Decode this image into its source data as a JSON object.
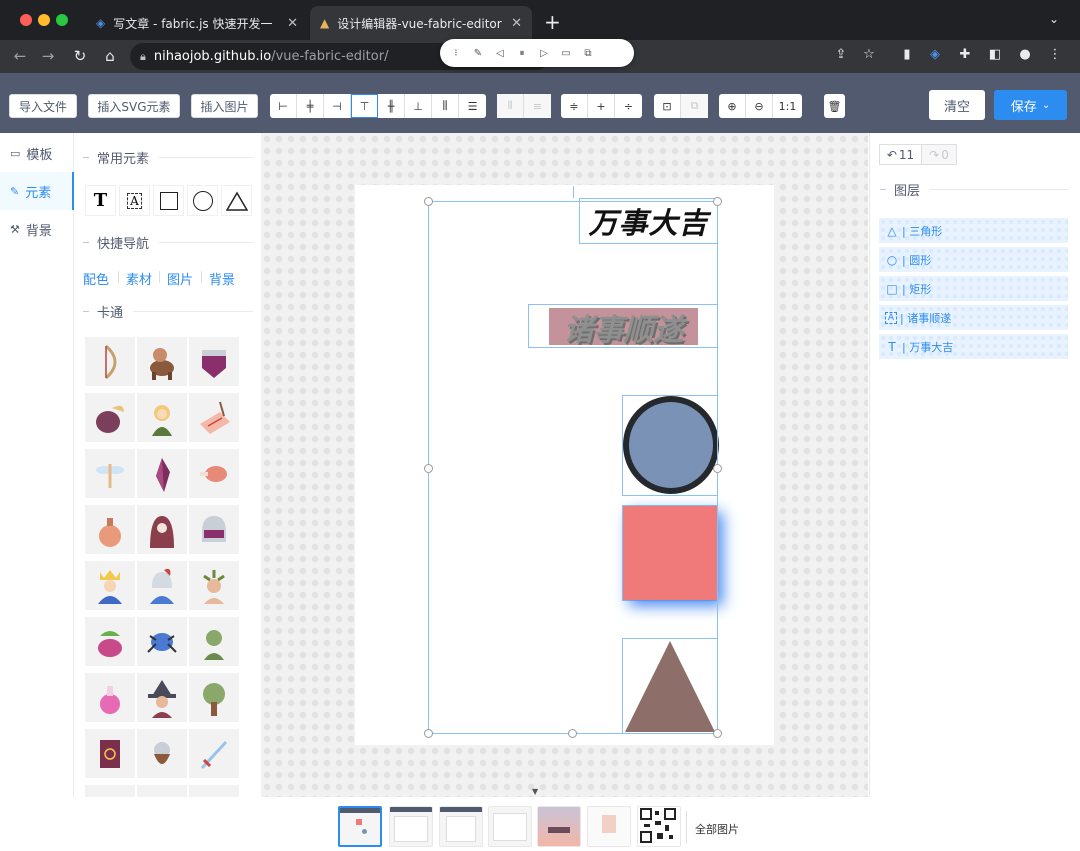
{
  "browser": {
    "tabs": [
      {
        "title": "写文章 - fabric.js 快速开发一个"
      },
      {
        "title": "设计编辑器-vue-fabric-editor"
      }
    ],
    "new_tab": "+",
    "url_host": "nihaojob.github.io",
    "url_path": "/vue-fabric-editor/"
  },
  "toolbar": {
    "import_file": "导入文件",
    "insert_svg": "插入SVG元素",
    "insert_image": "插入图片",
    "zoom_reset": "1:1",
    "clear": "清空",
    "save": "保存"
  },
  "left_menu": {
    "items": [
      {
        "label": "模板",
        "icon": "book-icon"
      },
      {
        "label": "元素",
        "icon": "pencil-icon"
      },
      {
        "label": "背景",
        "icon": "wrench-icon"
      }
    ]
  },
  "tool_panel": {
    "common_elements": "常用元素",
    "quick_nav": "快捷导航",
    "nav_links": [
      "配色",
      "素材",
      "图片",
      "背景"
    ],
    "cartoon": "卡通"
  },
  "canvas": {
    "text_wanshi": "万事大吉",
    "text_zhushi": "诸事顺遂",
    "circle_fill": "#7a92b5",
    "rect_fill": "#f07a7a",
    "triangle_fill": "#8d6e69"
  },
  "right_panel": {
    "undo_count": "11",
    "redo_count": "0",
    "layers_title": "图层",
    "layers": [
      {
        "label": "| 三角形",
        "icon": "triangle-icon"
      },
      {
        "label": "| 圆形",
        "icon": "circle-icon"
      },
      {
        "label": "| 矩形",
        "icon": "square-icon"
      },
      {
        "label": "| 诸事顺遂",
        "icon": "textbox-icon"
      },
      {
        "label": "| 万事大吉",
        "icon": "text-icon"
      }
    ]
  },
  "bottom_tray": {
    "all_images": "全部图片"
  },
  "colors": {
    "accent": "#2d8cf0",
    "toolbar_bg": "#515a6e"
  }
}
